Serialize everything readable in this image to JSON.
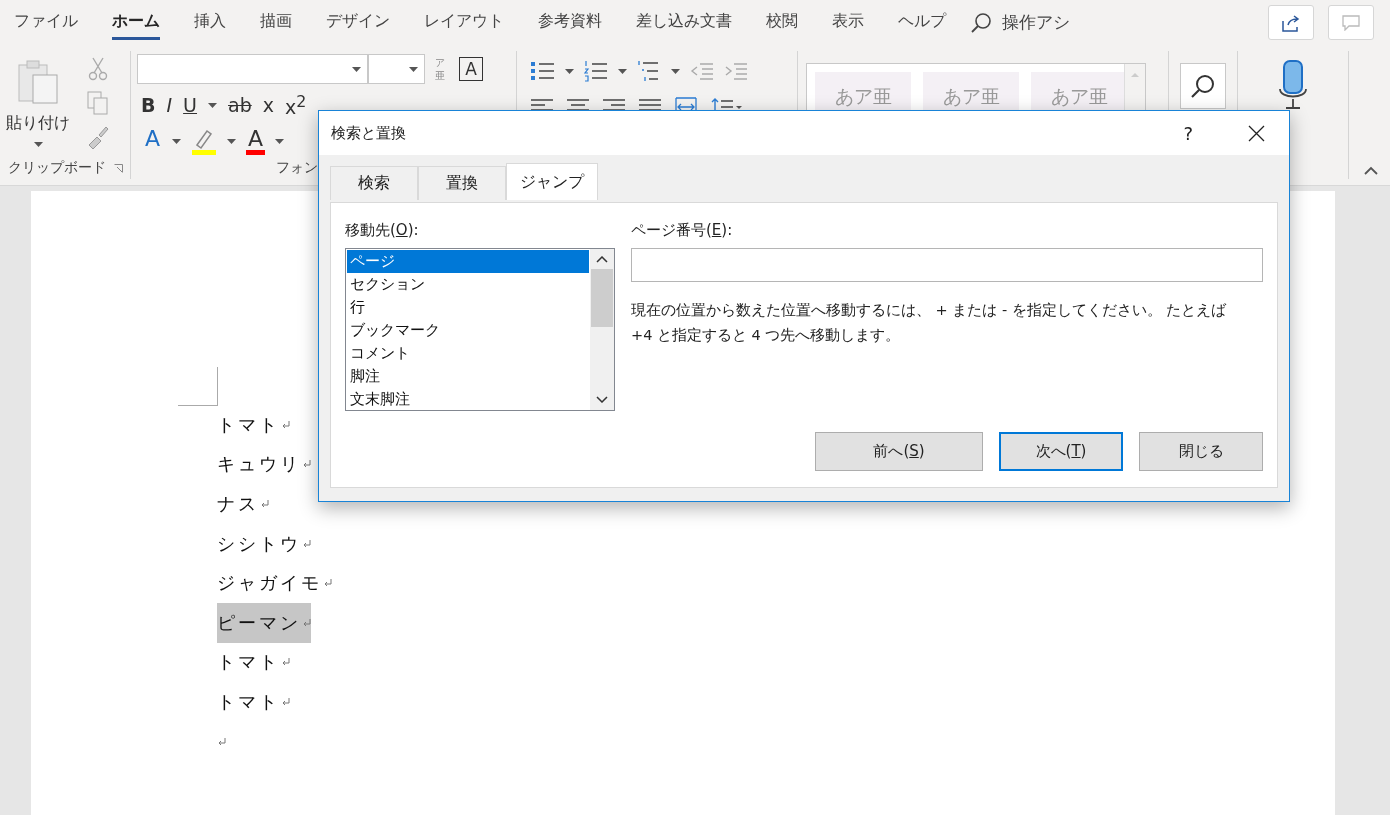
{
  "menu_tabs": [
    {
      "label": "ファイル",
      "selected": false
    },
    {
      "label": "ホーム",
      "selected": true
    },
    {
      "label": "挿入",
      "selected": false
    },
    {
      "label": "描画",
      "selected": false
    },
    {
      "label": "デザイン",
      "selected": false
    },
    {
      "label": "レイアウト",
      "selected": false
    },
    {
      "label": "参考資料",
      "selected": false
    },
    {
      "label": "差し込み文書",
      "selected": false
    },
    {
      "label": "校閲",
      "selected": false
    },
    {
      "label": "表示",
      "selected": false
    },
    {
      "label": "ヘルプ",
      "selected": false
    }
  ],
  "tell_me": {
    "text": "操作アシ"
  },
  "ribbon": {
    "clipboard": {
      "paste_label": "貼り付け",
      "group_label": "クリップボード"
    },
    "font": {
      "phonetic_guide": [
        "ア",
        "亜"
      ],
      "char_border": "A",
      "format_buttons": [
        "B",
        "I",
        "U",
        "ab",
        "x",
        "x$^{2}$"
      ],
      "text_effect": "A",
      "font_color": "A",
      "group_label": "フォン"
    },
    "styles": {
      "samples": [
        "あア亜",
        "あア亜",
        "あア亜"
      ]
    }
  },
  "document": {
    "paragraphs": [
      {
        "text": "トマト",
        "selected": false
      },
      {
        "text": "キュウリ",
        "selected": false
      },
      {
        "text": "ナス",
        "selected": false
      },
      {
        "text": "シシトウ",
        "selected": false
      },
      {
        "text": "ジャガイモ",
        "selected": false
      },
      {
        "text": "ピーマン",
        "selected": true
      },
      {
        "text": "トマト",
        "selected": false
      },
      {
        "text": "トマト",
        "selected": false
      }
    ]
  },
  "dialog": {
    "title": "検索と置換",
    "help": "?",
    "tabs": [
      {
        "label": "検索",
        "selected": false
      },
      {
        "label": "置換",
        "selected": false
      },
      {
        "label": "ジャンプ",
        "selected": true
      }
    ],
    "goto": {
      "label": "移動先(",
      "access_key": "O",
      "label_end": "):",
      "items": [
        {
          "label": "ページ",
          "selected": true
        },
        {
          "label": "セクション",
          "selected": false
        },
        {
          "label": "行",
          "selected": false
        },
        {
          "label": "ブックマーク",
          "selected": false
        },
        {
          "label": "コメント",
          "selected": false
        },
        {
          "label": "脚注",
          "selected": false
        },
        {
          "label": "文末脚注",
          "selected": false
        }
      ]
    },
    "page_number": {
      "label": "ページ番号(",
      "access_key": "E",
      "label_end": "):"
    },
    "help_text": "現在の位置から数えた位置へ移動するには、 + または - を指定してください。 たとえば +4 と指定すると 4 つ先へ移動します。",
    "buttons": [
      {
        "label": "前へ(",
        "access_key": "S",
        "label_end": ")",
        "default": false
      },
      {
        "label": "次へ(",
        "access_key": "T",
        "label_end": ")",
        "default": true
      },
      {
        "label": "閉じる",
        "default": false
      }
    ]
  }
}
